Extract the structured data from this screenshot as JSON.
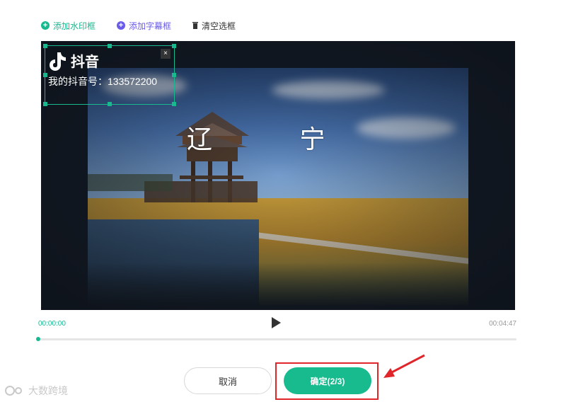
{
  "toolbar": {
    "add_watermark": "添加水印框",
    "add_subtitle": "添加字幕框",
    "clear_boxes": "清空选框"
  },
  "video": {
    "subtitle_text": "辽 宁",
    "watermark": {
      "app_name": "抖音",
      "account_line": "我的抖音号：133572200",
      "close_glyph": "×"
    }
  },
  "player": {
    "current_time": "00:00:00",
    "total_time": "00:04:47",
    "progress": 0
  },
  "footer": {
    "cancel_label": "取消",
    "confirm_label": "确定(2/3)"
  },
  "brand": {
    "text": "大数跨境"
  },
  "colors": {
    "accent": "#19b990",
    "purple": "#6a5ce8",
    "highlight": "#e0262b"
  },
  "icons": {
    "add_watermark": "plus-circle-icon",
    "add_subtitle": "plus-circle-icon",
    "clear": "trash-icon",
    "play": "play-icon",
    "close": "close-icon"
  }
}
